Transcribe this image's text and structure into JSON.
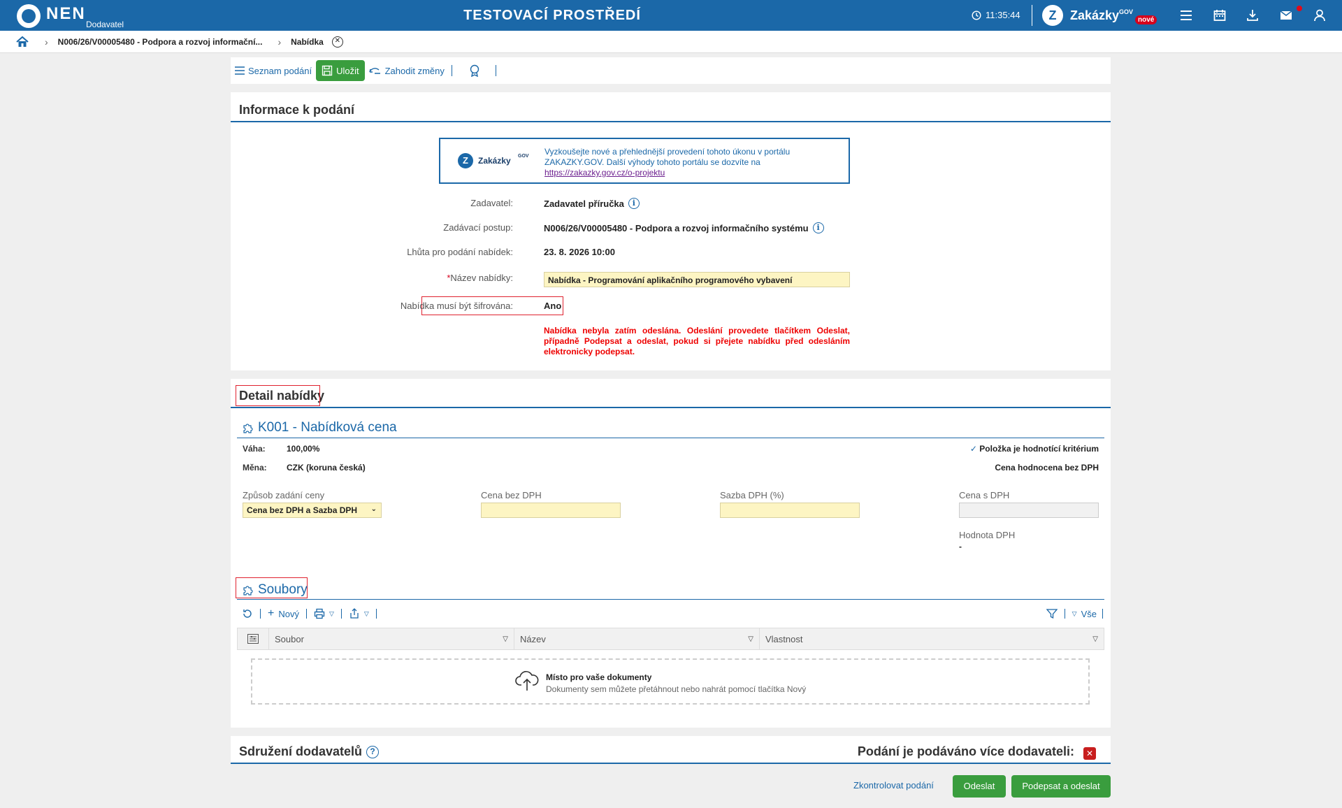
{
  "header": {
    "brand": "NEN",
    "brand_sub": "Dodavatel",
    "env_title": "TESTOVACÍ PROSTŘEDÍ",
    "clock": "11:35:44",
    "zakazky": "Zakázky",
    "zakazky_sup": "GOV",
    "new_badge": "nové",
    "icons": [
      "clock-icon",
      "menu-icon",
      "calendar-icon",
      "download-icon",
      "mail-icon",
      "user-icon"
    ]
  },
  "breadcrumb": {
    "items": [
      "N006/26/V00005480 - Podpora a rozvoj informační...",
      "Nabídka"
    ]
  },
  "toolbar": {
    "list_label": "Seznam podání",
    "save_label": "Uložit",
    "discard_label": "Zahodit změny"
  },
  "info_panel": {
    "title": "Informace k podání",
    "promo": {
      "logo_name": "Zakázky",
      "logo_sup": "GOV",
      "text": "Vyzkoušejte nové a přehlednější provedení tohoto úkonu v portálu ZAKAZKY.GOV. Další výhody tohoto portálu se dozvíte na",
      "link": "https://zakazky.gov.cz/o-projektu"
    },
    "fields": {
      "zadavatel_label": "Zadavatel:",
      "zadavatel_value": "Zadavatel příručka",
      "postup_label": "Zadávací postup:",
      "postup_value": "N006/26/V00005480 - Podpora a rozvoj informačního systému",
      "lhuta_label": "Lhůta pro podání nabídek:",
      "lhuta_value": "23. 8. 2026 10:00",
      "nazev_label": "Název nabídky:",
      "nazev_required": "*",
      "nazev_value": "Nabídka - Programování aplikačního programového vybavení",
      "sifrovana_label": "Nabídka musí být šifrována:",
      "sifrovana_value": "Ano"
    },
    "warning": "Nabídka nebyla zatím odeslána. Odeslání provedete tlačítkem Odeslat, případně Podepsat a odeslat, pokud si přejete nabídku před odesláním elektronicky podepsat."
  },
  "detail_panel": {
    "title": "Detail nabídky",
    "criterion": {
      "title": "K001 - Nabídková cena",
      "vaha_label": "Váha:",
      "vaha_value": "100,00%",
      "mena_label": "Měna:",
      "mena_value": "CZK (koruna česká)",
      "hodnotici": "Položka je hodnotící kritérium",
      "hodnocena": "Cena hodnocena bez DPH",
      "zpusob_label": "Způsob zadání ceny",
      "zpusob_value": "Cena bez DPH a Sazba DPH",
      "cena_bez_label": "Cena bez DPH",
      "sazba_label": "Sazba DPH (%)",
      "cena_s_label": "Cena s DPH",
      "hodnota_label": "Hodnota DPH",
      "hodnota_value": "-"
    },
    "files": {
      "title": "Soubory",
      "new_label": "Nový",
      "filter_all": "Vše",
      "columns": [
        "Soubor",
        "Název",
        "Vlastnost"
      ],
      "dropzone_title": "Místo pro vaše dokumenty",
      "dropzone_sub": "Dokumenty sem můžete přetáhnout nebo nahrát pomocí tlačítka Nový"
    }
  },
  "association_panel": {
    "title": "Sdružení dodavatelů",
    "multi_label": "Podání je podáváno více dodavateli:"
  },
  "footer": {
    "check_label": "Zkontrolovat podání",
    "send_label": "Odeslat",
    "sign_send_label": "Podepsat a odeslat"
  },
  "colors": {
    "brand_blue": "#1b68a8",
    "green": "#3a9d3e",
    "warning_red": "#e00000",
    "field_yellow": "#fdf5c3"
  }
}
